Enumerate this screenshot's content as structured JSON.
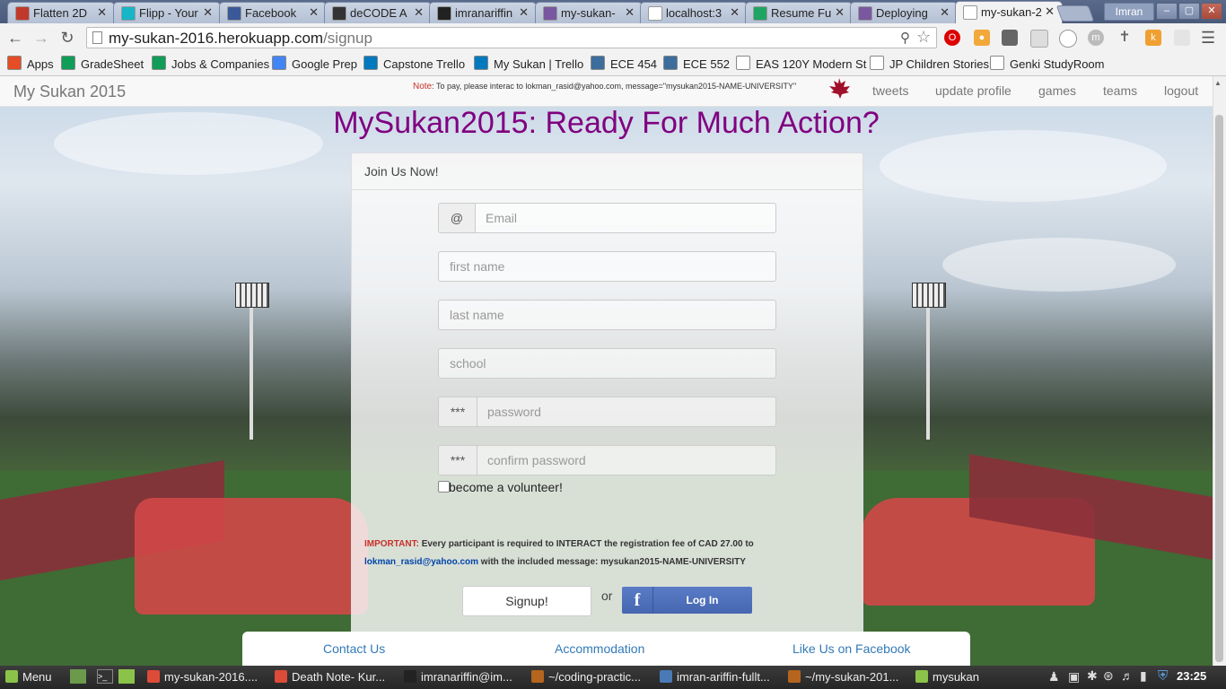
{
  "tabs": [
    {
      "title": "Flatten 2D",
      "favicon_color": "#c0392b"
    },
    {
      "title": "Flipp - Your",
      "favicon_color": "#16b5c8"
    },
    {
      "title": "Facebook",
      "favicon_color": "#3b5998"
    },
    {
      "title": "deCODE A",
      "favicon_color": "#333333"
    },
    {
      "title": "imranariffin",
      "favicon_color": "#222222"
    },
    {
      "title": "my-sukan-",
      "favicon_color": "#79589f"
    },
    {
      "title": "localhost:3",
      "favicon_color": "#ffffff"
    },
    {
      "title": "Resume Fu",
      "favicon_color": "#1fa463"
    },
    {
      "title": "Deploying",
      "favicon_color": "#79589f"
    },
    {
      "title": "my-sukan-2",
      "favicon_color": "#ffffff",
      "active": true
    }
  ],
  "close_glyph": "✕",
  "profile_name": "Imran",
  "window_buttons": [
    "–",
    "▢",
    "✕"
  ],
  "url": {
    "host": "my-sukan-2016.herokuapp.com",
    "path": "/signup"
  },
  "bookmarks": [
    {
      "label": "Apps",
      "icon_color": "#e44d26"
    },
    {
      "label": "GradeSheet",
      "icon_color": "#0f9d58"
    },
    {
      "label": "Jobs & Companies",
      "icon_color": "#0f9d58"
    },
    {
      "label": "Google Prep",
      "icon_color": "#4285f4"
    },
    {
      "label": "Capstone Trello",
      "icon_color": "#0079bf"
    },
    {
      "label": "My Sukan | Trello",
      "icon_color": "#0079bf"
    },
    {
      "label": "ECE 454",
      "icon_color": "#3c6d9c"
    },
    {
      "label": "ECE 552",
      "icon_color": "#3c6d9c"
    },
    {
      "label": "EAS 120Y Modern St",
      "icon_color": "#ffffff"
    },
    {
      "label": "JP Children Stories",
      "icon_color": "#ffffff"
    },
    {
      "label": "Genki StudyRoom",
      "icon_color": "#ffffff"
    }
  ],
  "navbar": {
    "brand": "My Sukan 2015",
    "note_label": "Note",
    "note_text": ": To pay, please interac to lokman_rasid@yahoo.com, message=\"mysukan2015-NAME-UNIVERSITY\"",
    "links": [
      "tweets",
      "update profile",
      "games",
      "teams",
      "logout"
    ]
  },
  "headline": "MySukan2015: Ready For Much Action?",
  "form": {
    "panel_title": "Join Us Now!",
    "email_addon": "@",
    "email_placeholder": "Email",
    "first_name_placeholder": "first name",
    "last_name_placeholder": "last name",
    "school_placeholder": "school",
    "password_addon": "***",
    "password_placeholder": "password",
    "confirm_addon": "***",
    "confirm_placeholder": "confirm password",
    "volunteer_label": "become a volunteer!",
    "important_label": "IMPORTANT:",
    "important_text": " Every participant is required to INTERACT the registration fee of CAD 27.00 to ",
    "important_email": "lokman_rasid@yahoo.com",
    "important_text2": " with the included message: mysukan2015-NAME-UNIVERSITY",
    "signup_label": "Signup!",
    "or_text": "or",
    "fb_logo": "f",
    "fb_label": "Log In"
  },
  "footer": [
    "Contact Us",
    "Accommodation",
    "Like Us on Facebook"
  ],
  "taskbar": {
    "menu_label": "Menu",
    "items": [
      {
        "label": "my-sukan-2016....",
        "icon_color": "#dd4b39"
      },
      {
        "label": "Death Note- Kur...",
        "icon_color": "#dd4b39"
      },
      {
        "label": "imranariffin@im...",
        "icon_color": "#222222"
      },
      {
        "label": "~/coding-practic...",
        "icon_color": "#b5651d"
      },
      {
        "label": "imran-ariffin-fullt...",
        "icon_color": "#4a7ab5"
      },
      {
        "label": "~/my-sukan-201...",
        "icon_color": "#b5651d"
      },
      {
        "label": "mysukan",
        "icon_color": "#8bc34a"
      }
    ],
    "clock": "23:25"
  }
}
